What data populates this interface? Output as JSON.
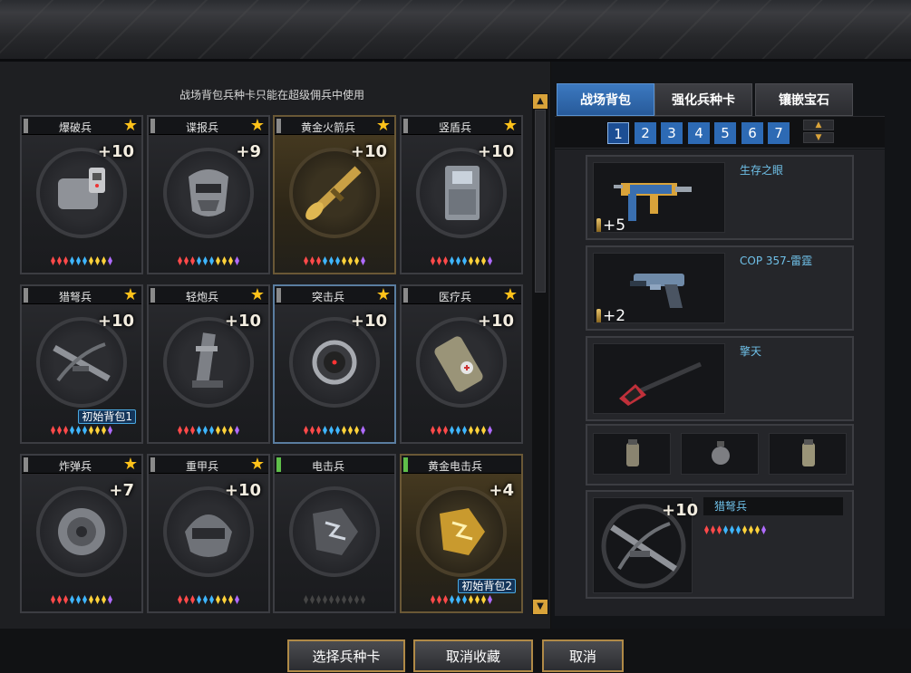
{
  "notice": "战场背包兵种卡只能在超级佣兵中使用",
  "cards": [
    {
      "name": "爆破兵",
      "level": "+10",
      "star": true,
      "marker": "gray",
      "theme": "normal",
      "icon": "c4-bomb-icon",
      "badge": ""
    },
    {
      "name": "谍报兵",
      "level": "+9",
      "star": true,
      "marker": "gray",
      "theme": "normal",
      "icon": "mask-helmet-icon",
      "badge": ""
    },
    {
      "name": "黄金火箭兵",
      "level": "+10",
      "star": true,
      "marker": "gray",
      "theme": "gold",
      "icon": "rocket-launcher-icon",
      "badge": ""
    },
    {
      "name": "竖盾兵",
      "level": "+10",
      "star": true,
      "marker": "gray",
      "theme": "normal",
      "icon": "riot-shield-icon",
      "badge": ""
    },
    {
      "name": "猎弩兵",
      "level": "+10",
      "star": true,
      "marker": "gray",
      "theme": "normal",
      "icon": "crossbow-icon",
      "badge": "初始背包1"
    },
    {
      "name": "轻炮兵",
      "level": "+10",
      "star": true,
      "marker": "gray",
      "theme": "normal",
      "icon": "mortar-icon",
      "badge": ""
    },
    {
      "name": "突击兵",
      "level": "+10",
      "star": true,
      "marker": "gray",
      "theme": "selected",
      "icon": "scope-icon",
      "badge": ""
    },
    {
      "name": "医疗兵",
      "level": "+10",
      "star": true,
      "marker": "gray",
      "theme": "normal",
      "icon": "medkit-grenade-icon",
      "badge": ""
    },
    {
      "name": "炸弹兵",
      "level": "+7",
      "star": true,
      "marker": "gray",
      "theme": "normal",
      "icon": "sphere-bomb-icon",
      "badge": ""
    },
    {
      "name": "重甲兵",
      "level": "+10",
      "star": true,
      "marker": "gray",
      "theme": "normal",
      "icon": "heavy-helmet-icon",
      "badge": ""
    },
    {
      "name": "电击兵",
      "level": "",
      "star": false,
      "marker": "green",
      "theme": "normal",
      "icon": "lightning-gauntlet-icon",
      "badge": ""
    },
    {
      "name": "黄金电击兵",
      "level": "+4",
      "star": false,
      "marker": "green",
      "theme": "gold",
      "icon": "gold-lightning-gauntlet-icon",
      "badge": "初始背包2"
    }
  ],
  "tabs": [
    {
      "label": "战场背包",
      "active": true
    },
    {
      "label": "强化兵种卡",
      "active": false
    },
    {
      "label": "镶嵌宝石",
      "active": false
    }
  ],
  "pages": [
    "1",
    "2",
    "3",
    "4",
    "5",
    "6",
    "7"
  ],
  "active_page": "1",
  "weapons": [
    {
      "name": "生存之眼",
      "ammo": "+5",
      "icon": "smg-icon"
    },
    {
      "name": "COP 357-雷霆",
      "ammo": "+2",
      "icon": "pistol-icon"
    },
    {
      "name": "擎天",
      "ammo": "",
      "icon": "shovel-icon"
    }
  ],
  "grenades": [
    "grenade-icon",
    "flash-grenade-icon",
    "smoke-grenade-icon"
  ],
  "equipped_unit": {
    "name": "猎弩兵",
    "level": "+10",
    "icon": "crossbow-icon"
  },
  "buttons": {
    "select": "选择兵种卡",
    "unfavorite": "取消收藏",
    "cancel": "取消"
  },
  "colors": {
    "accent_blue": "#2d6ab4",
    "gold_border": "#b08a47",
    "star": "#ffc21a",
    "weapon_name": "#6fc0e8"
  }
}
